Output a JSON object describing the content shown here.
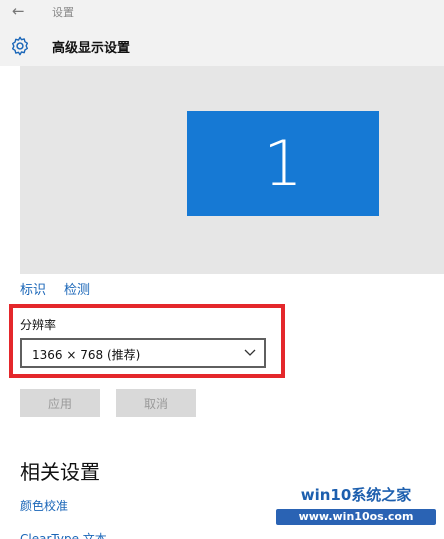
{
  "window": {
    "title": "设置"
  },
  "header": {
    "title": "高级显示设置"
  },
  "preview": {
    "monitor_number": "1"
  },
  "display_links": {
    "identify": "标识",
    "detect": "检测"
  },
  "resolution": {
    "label": "分辨率",
    "selected_value": "1366 × 768 (推荐)"
  },
  "buttons": {
    "apply": "应用",
    "cancel": "取消"
  },
  "related": {
    "title": "相关设置",
    "color_calibration": "颜色校准",
    "cleartype": "ClearType 文本"
  },
  "watermark": {
    "title": "win10系统之家",
    "url": "www.win10os.com"
  },
  "colors": {
    "accent": "#1679d4",
    "highlight": "#e4272b",
    "link": "#1a66b8"
  }
}
